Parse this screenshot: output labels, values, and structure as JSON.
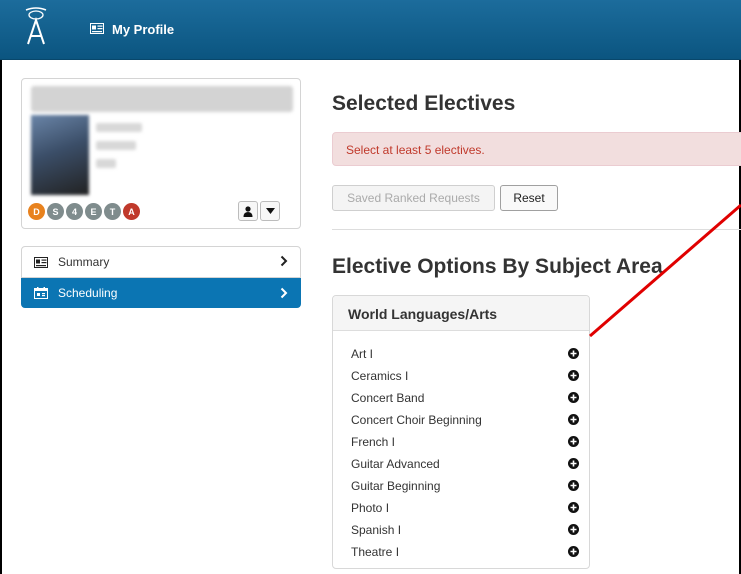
{
  "header": {
    "nav_label": "My Profile"
  },
  "profile": {
    "badges": [
      {
        "letter": "D",
        "color": "#e8821e"
      },
      {
        "letter": "S",
        "color": "#7f8c8d"
      },
      {
        "letter": "4",
        "color": "#7f8c8d"
      },
      {
        "letter": "E",
        "color": "#7f8c8d"
      },
      {
        "letter": "T",
        "color": "#7f8c8d"
      },
      {
        "letter": "A",
        "color": "#c0392b"
      }
    ]
  },
  "sidebar": {
    "items": [
      {
        "label": "Summary",
        "icon": "profile-card-icon",
        "active": false
      },
      {
        "label": "Scheduling",
        "icon": "calendar-icon",
        "active": true
      }
    ]
  },
  "main": {
    "title": "Selected Electives",
    "alert": "Select at least 5 electives.",
    "saved_button": "Saved Ranked Requests",
    "reset_button": "Reset",
    "section_title": "Elective Options By Subject Area",
    "panel": {
      "heading": "World Languages/Arts",
      "items": [
        "Art I",
        "Ceramics I",
        "Concert Band",
        "Concert Choir Beginning",
        "French I",
        "Guitar Advanced",
        "Guitar Beginning",
        "Photo I",
        "Spanish I",
        "Theatre I"
      ]
    }
  },
  "colors": {
    "header": "#0b5580",
    "active_nav": "#0b75b3",
    "alert_bg": "#f2dede",
    "alert_text": "#c0392b",
    "annotation": "#e00000"
  }
}
